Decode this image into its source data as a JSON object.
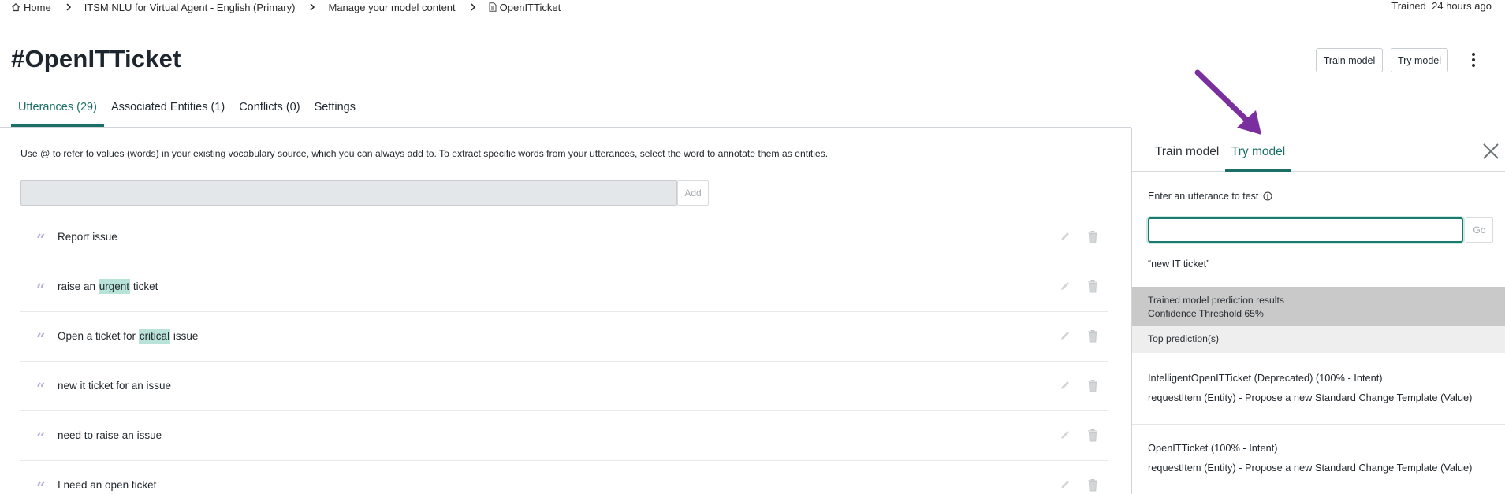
{
  "breadcrumb": {
    "home": "Home",
    "items": [
      "ITSM NLU for Virtual Agent - English (Primary)",
      "Manage your model content",
      "OpenITTicket"
    ]
  },
  "status": {
    "trained_label": "Trained",
    "trained_time": "24 hours ago"
  },
  "page_title": "#OpenITTicket",
  "header_buttons": {
    "train": "Train model",
    "try": "Try model"
  },
  "tabs": [
    {
      "label": "Utterances (29)",
      "active": true
    },
    {
      "label": "Associated Entities (1)",
      "active": false
    },
    {
      "label": "Conflicts (0)",
      "active": false
    },
    {
      "label": "Settings",
      "active": false
    }
  ],
  "utterances": {
    "hint": "Use @ to refer to values (words) in your existing vocabulary source, which you can always add to. To extract specific words from your utterances, select the word to annotate them as entities.",
    "input_value": "",
    "add_label": "Add",
    "items": [
      {
        "before": "Report issue",
        "entity": "",
        "after": ""
      },
      {
        "before": "raise an ",
        "entity": "urgent",
        "after": " ticket"
      },
      {
        "before": "Open a ticket for ",
        "entity": "critical",
        "after": " issue"
      },
      {
        "before": "new it ticket for an issue",
        "entity": "",
        "after": ""
      },
      {
        "before": "need to raise an issue",
        "entity": "",
        "after": ""
      },
      {
        "before": "I need an open ticket",
        "entity": "",
        "after": ""
      }
    ]
  },
  "panel": {
    "tabs": [
      "Train model",
      "Try model"
    ],
    "active_tab": "Try model",
    "enter_label": "Enter an utterance to test",
    "input_value": "",
    "go_label": "Go",
    "tested_utterance": "“new IT ticket”",
    "results_title": "Trained model prediction results",
    "confidence": "Confidence Threshold 65%",
    "top_predictions_label": "Top prediction(s)",
    "predictions": [
      {
        "intent": "IntelligentOpenITTicket (Deprecated) (100% - Intent)",
        "entity": "requestItem (Entity) - Propose a new Standard Change Template (Value)"
      },
      {
        "intent": "OpenITTicket (100% - Intent)",
        "entity": "requestItem (Entity) - Propose a new Standard Change Template (Value)"
      }
    ]
  },
  "colors": {
    "accent": "#1b6f66",
    "entity_highlight": "#b9e3d8",
    "annotation_arrow": "#7b2f9e",
    "results_header_bg": "#c9c9c9"
  }
}
